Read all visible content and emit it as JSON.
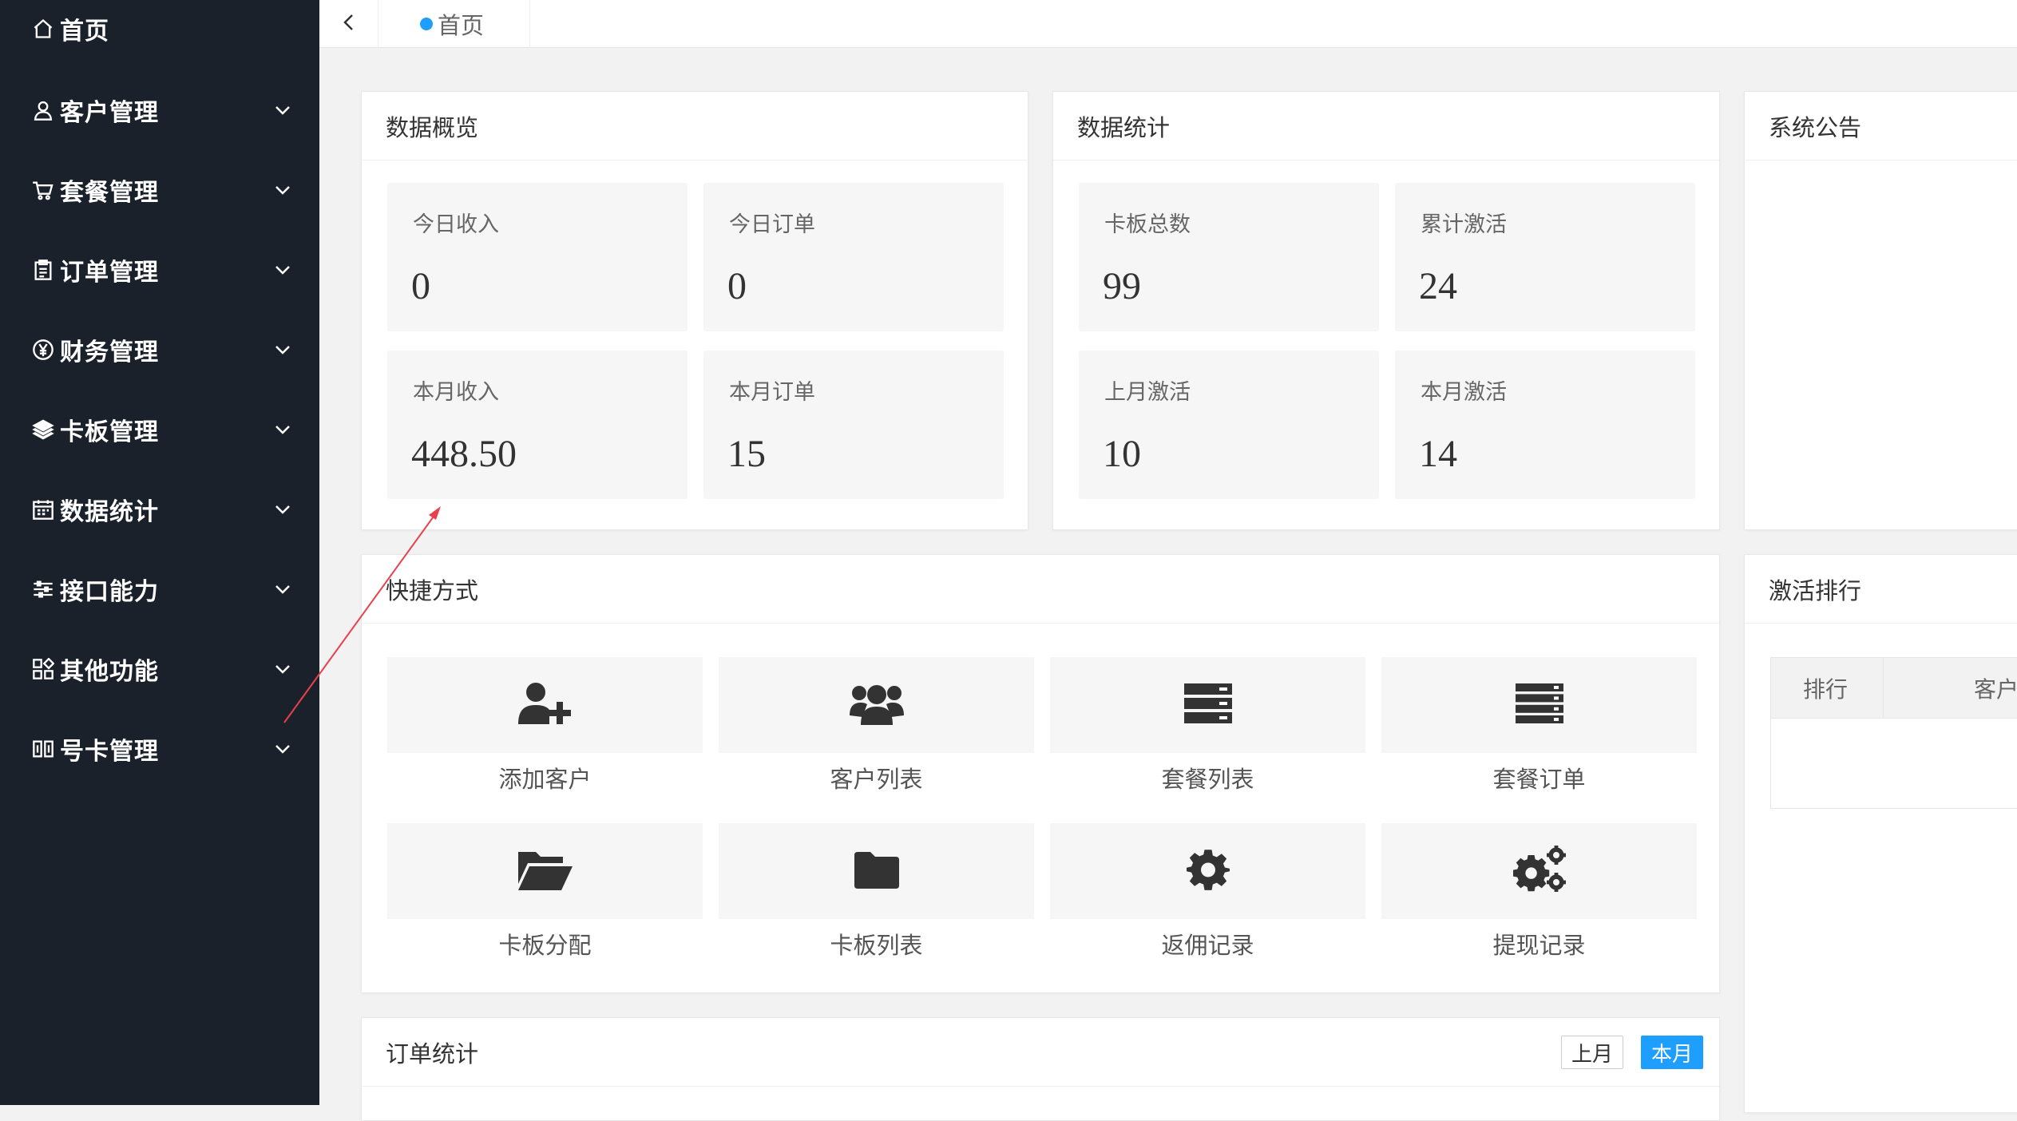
{
  "sidebar": {
    "items": [
      {
        "label": "首页",
        "icon": "home-icon"
      },
      {
        "label": "客户管理",
        "icon": "user-icon"
      },
      {
        "label": "套餐管理",
        "icon": "cart-icon"
      },
      {
        "label": "订单管理",
        "icon": "clipboard-icon"
      },
      {
        "label": "财务管理",
        "icon": "yen-icon"
      },
      {
        "label": "卡板管理",
        "icon": "layers-icon"
      },
      {
        "label": "数据统计",
        "icon": "calendar-icon"
      },
      {
        "label": "接口能力",
        "icon": "sliders-icon"
      },
      {
        "label": "其他功能",
        "icon": "apps-icon"
      },
      {
        "label": "号卡管理",
        "icon": "sim-icon"
      }
    ]
  },
  "tabs": {
    "home": "首页"
  },
  "overview": {
    "title": "数据概览",
    "stats": [
      {
        "label": "今日收入",
        "value": "0"
      },
      {
        "label": "今日订单",
        "value": "0"
      },
      {
        "label": "本月收入",
        "value": "448.50"
      },
      {
        "label": "本月订单",
        "value": "15"
      }
    ]
  },
  "statistics": {
    "title": "数据统计",
    "stats": [
      {
        "label": "卡板总数",
        "value": "99"
      },
      {
        "label": "累计激活",
        "value": "24"
      },
      {
        "label": "上月激活",
        "value": "10"
      },
      {
        "label": "本月激活",
        "value": "14"
      }
    ]
  },
  "notice": {
    "title": "系统公告"
  },
  "shortcuts": {
    "title": "快捷方式",
    "items": [
      {
        "label": "添加客户",
        "icon": "add-user-icon"
      },
      {
        "label": "客户列表",
        "icon": "users-icon"
      },
      {
        "label": "套餐列表",
        "icon": "server-icon"
      },
      {
        "label": "套餐订单",
        "icon": "server-list-icon"
      },
      {
        "label": "卡板分配",
        "icon": "folder-open-icon"
      },
      {
        "label": "卡板列表",
        "icon": "folder-icon"
      },
      {
        "label": "返佣记录",
        "icon": "gear-icon"
      },
      {
        "label": "提现记录",
        "icon": "gears-icon"
      }
    ]
  },
  "ranking": {
    "title": "激活排行",
    "col_rank": "排行",
    "col_customer": "客户"
  },
  "orders": {
    "title": "订单统计",
    "last_month": "上月",
    "this_month": "本月"
  },
  "colors": {
    "sidebar_bg": "#1b212b",
    "accent": "#1e9fff",
    "annotation_arrow": "#e8414d"
  }
}
